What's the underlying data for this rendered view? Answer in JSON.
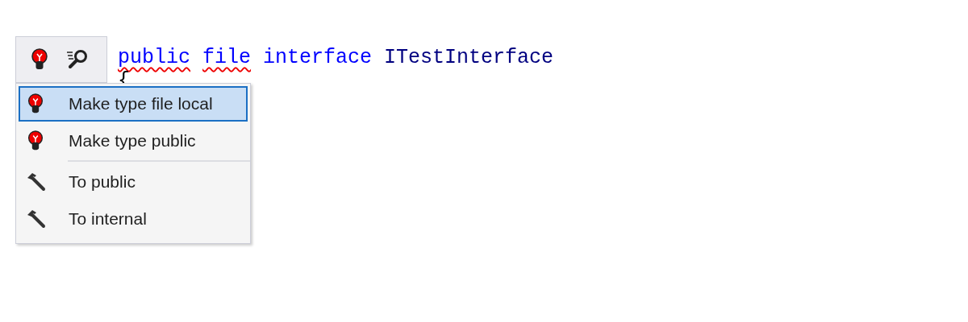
{
  "code_lines": [
    {
      "tokens": [
        {
          "text": "public",
          "kind": "keyword",
          "squiggle": true
        },
        {
          "text": "file",
          "kind": "keyword",
          "squiggle": true
        },
        {
          "text": "interface",
          "kind": "keyword",
          "squiggle": false
        },
        {
          "text": "ITestInterface",
          "kind": "type",
          "squiggle": false
        }
      ]
    },
    {
      "tokens": [
        {
          "text": "{",
          "kind": "punct",
          "squiggle": false
        }
      ]
    }
  ],
  "toolbar": [
    {
      "kind": "bulb"
    },
    {
      "kind": "search"
    }
  ],
  "menu": [
    {
      "label": "Make type file local",
      "kind": "bulb",
      "selected": true,
      "separator_before": false
    },
    {
      "label": "Make type public",
      "kind": "bulb",
      "selected": false,
      "separator_before": false
    },
    {
      "label": "To public",
      "kind": "hammer",
      "selected": false,
      "separator_before": true
    },
    {
      "label": "To internal",
      "kind": "hammer",
      "selected": false,
      "separator_before": false
    }
  ]
}
